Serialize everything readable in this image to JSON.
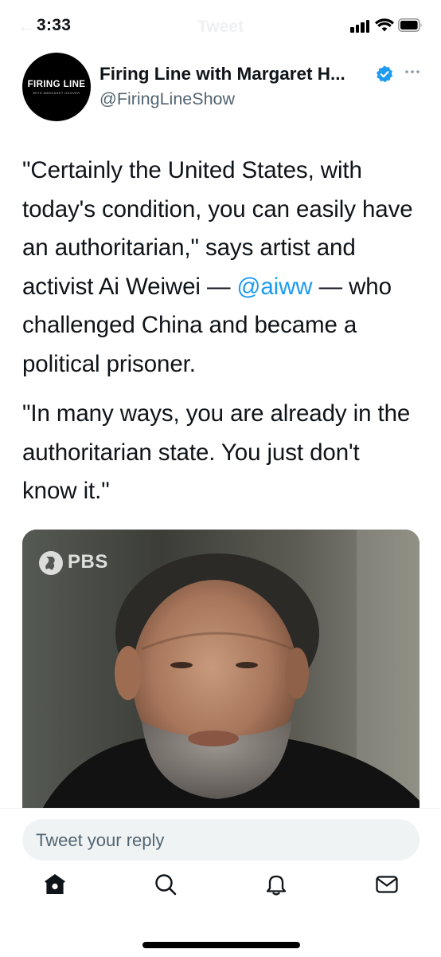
{
  "status_bar": {
    "time": "3:33",
    "ghost_title": "Tweet",
    "icons": [
      "signal-icon",
      "wifi-icon",
      "battery-icon"
    ]
  },
  "tweet": {
    "author": {
      "display_name": "Firing Line with Margaret H...",
      "handle": "@FiringLineShow",
      "verified": true,
      "avatar_text": "FIRING LINE",
      "avatar_subtext": "WITH MARGARET HOOVER"
    },
    "paragraphs": [
      {
        "before": "\"Certainly the United States, with today's condition, you can easily have an authoritarian,\" says artist and activist Ai Weiwei — ",
        "mention": "@aiww",
        "after": " — who challenged China and became a political prisoner."
      },
      {
        "text": "\"In many ways, you are already in the authoritarian state. You just don't know it.\""
      }
    ],
    "media": {
      "watermark": "PBS",
      "description_icon": "pbs-logo-icon"
    }
  },
  "reply": {
    "placeholder": "Tweet your reply"
  },
  "tab_bar": {
    "items": [
      "home-icon",
      "search-icon",
      "notifications-icon",
      "messages-icon"
    ]
  },
  "colors": {
    "link": "#1d9bf0",
    "text": "#0f1419",
    "secondary": "#536471",
    "reply_bg": "#eff3f4"
  }
}
